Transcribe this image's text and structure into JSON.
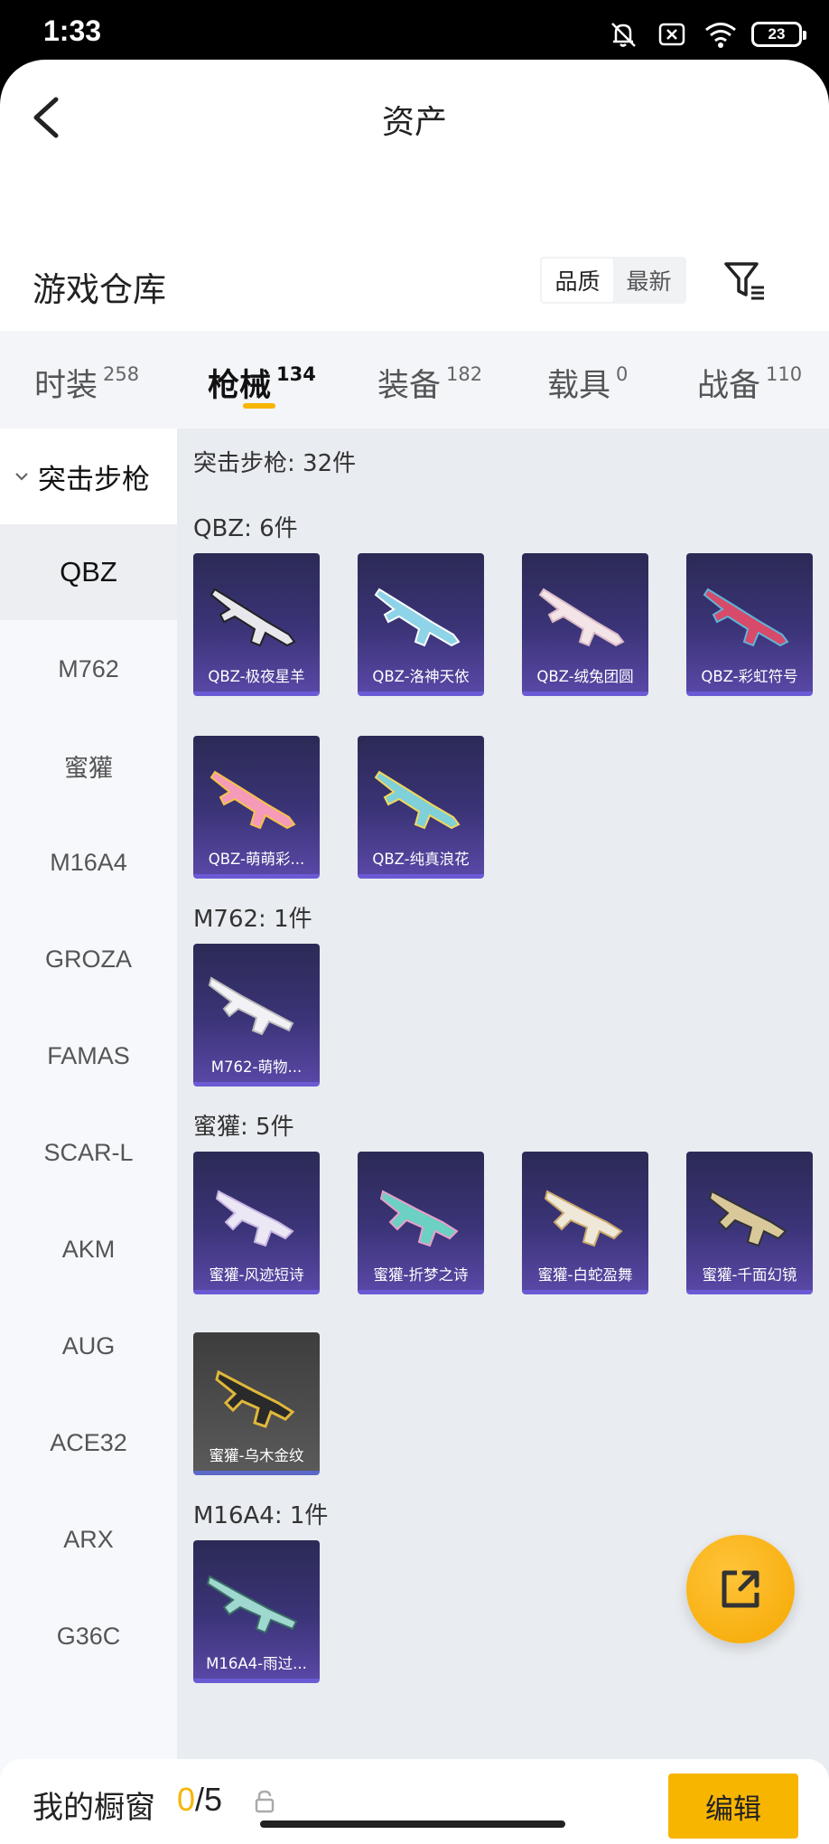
{
  "status_bar": {
    "time": "1:33",
    "battery": "23"
  },
  "header": {
    "title": "资产"
  },
  "warehouse": {
    "title": "游戏仓库",
    "sort_options": [
      "品质",
      "最新"
    ]
  },
  "tabs": [
    {
      "label": "时装",
      "count": "258"
    },
    {
      "label": "枪械",
      "count": "134"
    },
    {
      "label": "装备",
      "count": "182"
    },
    {
      "label": "载具",
      "count": "0"
    },
    {
      "label": "战备",
      "count": "110"
    }
  ],
  "sidebar": {
    "category": "突击步枪",
    "items": [
      "QBZ",
      "M762",
      "蜜獾",
      "M16A4",
      "GROZA",
      "FAMAS",
      "SCAR-L",
      "AKM",
      "AUG",
      "ACE32",
      "ARX",
      "G36C"
    ]
  },
  "content": {
    "summary": "突击步枪: 32件",
    "groups": [
      {
        "title": "QBZ: 6件",
        "items": [
          "QBZ-极夜星羊",
          "QBZ-洛神天依",
          "QBZ-绒兔团圆",
          "QBZ-彩虹符号",
          "QBZ-萌萌彩...",
          "QBZ-纯真浪花"
        ]
      },
      {
        "title": "M762: 1件",
        "items": [
          "M762-萌物..."
        ]
      },
      {
        "title": "蜜獾: 5件",
        "items": [
          "蜜獾-风迹短诗",
          "蜜獾-折梦之诗",
          "蜜獾-白蛇盈舞",
          "蜜獾-千面幻镜",
          "蜜獾-乌木金纹"
        ]
      },
      {
        "title": "M16A4: 1件",
        "items": [
          "M16A4-雨过..."
        ]
      }
    ]
  },
  "bottom_bar": {
    "label": "我的橱窗",
    "current": "0",
    "total": "/5",
    "edit_label": "编辑"
  },
  "colors": {
    "accent": "#f7b500",
    "card": "#3b3478"
  }
}
